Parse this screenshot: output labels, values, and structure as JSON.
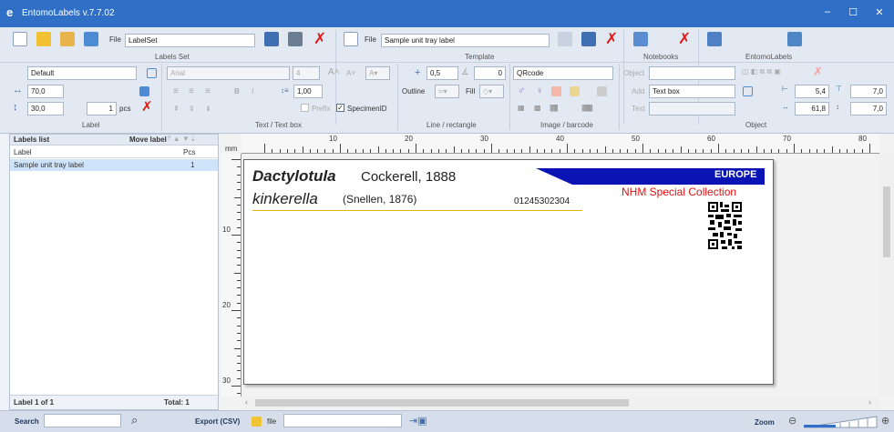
{
  "window": {
    "title": "EntomoLabels v.7.7.02",
    "logo": "e"
  },
  "ribbon": {
    "labelset": {
      "file_label": "File",
      "file_value": "LabelSet",
      "group": "Labels Set"
    },
    "template": {
      "file_label": "File",
      "file_value": "Sample unit tray label",
      "group": "Template"
    },
    "notebooks": {
      "group": "Notebooks"
    },
    "entomolabels": {
      "group": "EntomoLabels"
    },
    "label_group": {
      "preset": "Default",
      "width": "70,0",
      "height": "30,0",
      "pcs_value": "1",
      "pcs_label": "pcs",
      "group": "Label"
    },
    "text_group": {
      "font": "Arial",
      "size": "4",
      "line_spacing": "1,00",
      "prefix": "Prefix",
      "specimen_id": "SpecimenID",
      "group": "Text / Text box"
    },
    "line_group": {
      "width": "0,5",
      "angle": "0",
      "outline": "Outline",
      "fill": "Fill",
      "group": "Line / rectangle"
    },
    "image_group": {
      "code_type": "QRcode",
      "group": "Image / barcode"
    },
    "object_group": {
      "object_label": "Object",
      "object_value": "",
      "add_label": "Add",
      "add_value": "Text box",
      "text_label": "Text",
      "text_value": "",
      "x": "5,4",
      "y": "7,0",
      "w": "61,8",
      "h": "7,0",
      "group": "Object"
    }
  },
  "left_panel": {
    "title": "Labels list",
    "move_label": "Move label",
    "col_label": "Label",
    "col_pcs": "Pcs",
    "rows": [
      {
        "label": "Sample unit tray label",
        "pcs": "1"
      }
    ],
    "footer_left": "Label 1 of 1",
    "footer_right": "Total: 1"
  },
  "ruler": {
    "unit": "mm",
    "h_ticks": [
      "10",
      "20",
      "30",
      "40",
      "50",
      "60",
      "70",
      "80"
    ],
    "v_ticks": [
      "10",
      "20",
      "30"
    ]
  },
  "label_content": {
    "genus": "Dactylotula",
    "author1": "Cockerell, 1888",
    "species": "kinkerella",
    "author2": "(Snellen, 1876)",
    "number": "01245302304",
    "region": "EUROPE",
    "collection": "NHM Special Collection"
  },
  "statusbar": {
    "search_label": "Search",
    "search_value": "",
    "export_label": "Export (CSV)",
    "file_label": "file",
    "file_value": "",
    "zoom_label": "Zoom"
  },
  "colors": {
    "titlebar": "#2f6fc6",
    "banner": "#0a14b4",
    "collection": "#e01010",
    "underline": "#e3b400"
  }
}
